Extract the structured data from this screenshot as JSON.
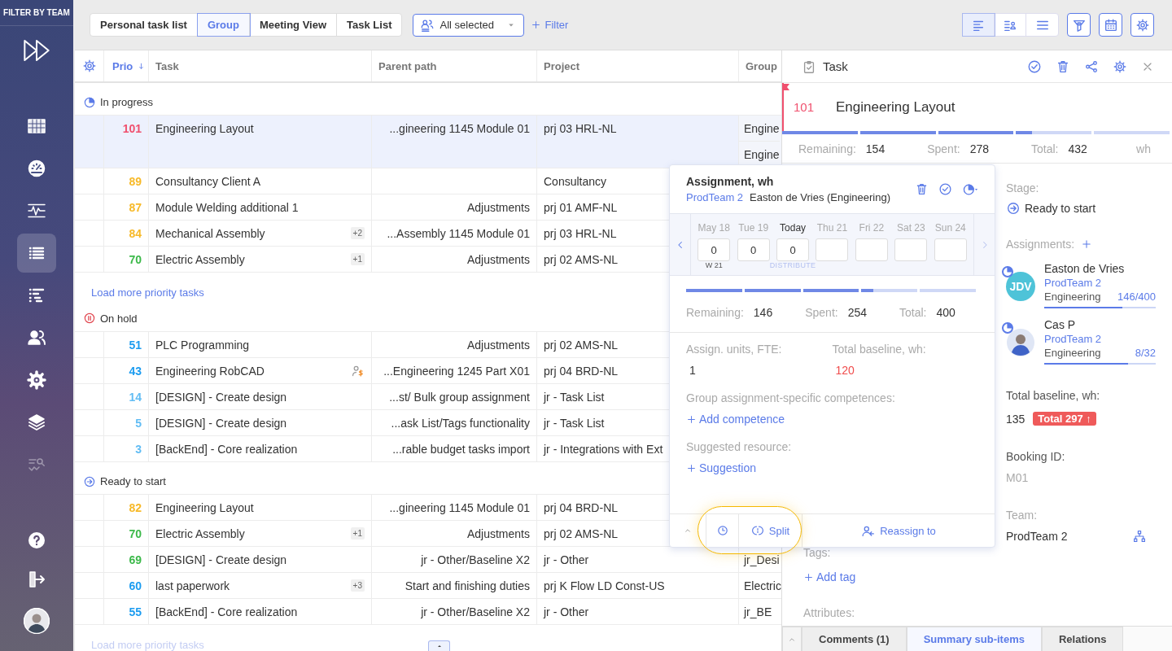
{
  "sidebar": {
    "title": "FILTER BY TEAM",
    "items": [
      {
        "selected": false,
        "disabled": false
      },
      {
        "selected": false,
        "disabled": false
      },
      {
        "selected": false,
        "disabled": false
      },
      {
        "selected": true,
        "disabled": false
      },
      {
        "selected": false,
        "disabled": false
      },
      {
        "selected": false,
        "disabled": false
      },
      {
        "selected": false,
        "disabled": false
      },
      {
        "selected": false,
        "disabled": false
      },
      {
        "selected": false,
        "disabled": true
      }
    ]
  },
  "toolbar": {
    "tabs": [
      {
        "label": "Personal task list",
        "selected": false
      },
      {
        "label": "Group",
        "selected": true
      },
      {
        "label": "Meeting View",
        "selected": false
      },
      {
        "label": "Task List",
        "selected": false
      }
    ],
    "team_filter": {
      "value": "All selected"
    },
    "add_filter": {
      "label": "Filter"
    },
    "view_modes": [
      {
        "selected": true
      },
      {
        "selected": false
      },
      {
        "selected": false
      }
    ]
  },
  "table": {
    "columns": [
      {
        "label": "Prio",
        "sorted": true
      },
      {
        "label": "Task",
        "sorted": false
      },
      {
        "label": "Parent path",
        "sorted": false
      },
      {
        "label": "Project",
        "sorted": false
      },
      {
        "label": "Group",
        "sorted": false
      }
    ],
    "sections": [
      {
        "title": "In progress",
        "kind": "in_progress",
        "rows": [
          {
            "prio": "101",
            "color": "#f0506e",
            "task": "Engineering Layout",
            "parent": "...gineering 1145 Module 01",
            "project": "prj 03 HRL-NL",
            "groups": [
              "Engine",
              "Engine"
            ],
            "cost_marker": false,
            "selected": true
          },
          {
            "prio": "89",
            "color": "#f7b928",
            "task": "Consultancy Client A",
            "project": "Consultancy",
            "cost_marker": false,
            "selected": false
          },
          {
            "prio": "87",
            "color": "#f7b928",
            "task": "Module Welding additional 1",
            "parent": "Adjustments",
            "project": "prj 01 AMF-NL",
            "cost_marker": false,
            "selected": false
          },
          {
            "prio": "84",
            "color": "#f7b928",
            "task": "Mechanical Assembly",
            "badge": "+2",
            "parent": "...Assembly 1145 Module 01",
            "project": "prj 03 HRL-NL",
            "cost_marker": false,
            "selected": false
          },
          {
            "prio": "70",
            "color": "#3cb94a",
            "task": "Electric Assembly",
            "badge": "+1",
            "parent": "Adjustments",
            "project": "prj 02 AMS-NL",
            "cost_marker": false,
            "selected": false
          }
        ],
        "load_more": {
          "label": "Load more priority tasks",
          "faded": false
        }
      },
      {
        "title": "On hold",
        "kind": "on_hold",
        "rows": [
          {
            "prio": "51",
            "color": "#1c9cf0",
            "task": "PLC Programming",
            "parent": "Adjustments",
            "project": "prj 02 AMS-NL",
            "cost_marker": false,
            "selected": false
          },
          {
            "prio": "43",
            "color": "#1c9cf0",
            "task": "Engineering RobCAD",
            "parent": "...Engineering 1245 Part X01",
            "project": "prj 04 BRD-NL",
            "cost_marker": true,
            "selected": false
          },
          {
            "prio": "14",
            "color": "#62bdf4",
            "task": "[DESIGN] - Create design",
            "parent": "...st/ Bulk group assignment",
            "project": "jr - Task List",
            "cost_marker": false,
            "selected": false
          },
          {
            "prio": "5",
            "color": "#62bdf4",
            "task": "[DESIGN] - Create design",
            "parent": "...ask List/Tags functionality",
            "project": "jr - Task List",
            "cost_marker": false,
            "selected": false
          },
          {
            "prio": "3",
            "color": "#62bdf4",
            "task": "[BackEnd] - Core realization",
            "parent": "...rable budget tasks import",
            "project": "jr - Integrations with Ext",
            "cost_marker": false,
            "selected": false
          }
        ]
      },
      {
        "title": "Ready to start",
        "kind": "ready",
        "rows": [
          {
            "prio": "82",
            "color": "#f7b928",
            "task": "Engineering Layout",
            "parent": "...gineering 1145 Module 01",
            "project": "prj 04 BRD-NL",
            "cost_marker": false,
            "selected": false
          },
          {
            "prio": "70",
            "color": "#3cb94a",
            "task": "Electric Assembly",
            "badge": "+1",
            "parent": "Adjustments",
            "project": "prj 02 AMS-NL",
            "cost_marker": false,
            "selected": false
          },
          {
            "prio": "69",
            "color": "#3cb94a",
            "task": "[DESIGN] - Create design",
            "parent": "jr - Other/Baseline X2",
            "project": "jr - Other",
            "groups": [
              "jr_Desi"
            ],
            "cost_marker": false,
            "selected": false
          },
          {
            "prio": "60",
            "color": "#1c9cf0",
            "task": "last paperwork",
            "badge": "+3",
            "parent": "Start and finishing duties",
            "project": "prj K Flow LD Const-US",
            "groups": [
              "Electric"
            ],
            "cost_marker": false,
            "selected": false
          },
          {
            "prio": "55",
            "color": "#1c9cf0",
            "task": "[BackEnd] - Core realization",
            "parent": "jr - Other/Baseline X2",
            "project": "jr - Other",
            "groups": [
              "jr_BE"
            ],
            "cost_marker": false,
            "selected": false
          }
        ],
        "load_more": {
          "label": "Load more priority tasks",
          "faded": true
        }
      }
    ]
  },
  "detail": {
    "title": "Task",
    "prio": "101",
    "name": "Engineering Layout",
    "progress": {
      "level": 0.64
    },
    "stats": [
      {
        "label": "Remaining:",
        "value": "154"
      },
      {
        "label": "Spent:",
        "value": "278"
      },
      {
        "label": "Total:",
        "value": "432"
      }
    ],
    "unit": "wh",
    "stage": {
      "label": "Stage:",
      "value": "Ready to start"
    },
    "assignments": {
      "label": "Assignments:",
      "people": [
        {
          "kind": "initials",
          "initials": "JDV",
          "name": "Easton de Vries",
          "team": "ProdTeam 2",
          "role": "Engineering",
          "hours": "146/400",
          "level": 0.7
        },
        {
          "kind": "picture",
          "name": "Cas P",
          "team": "ProdTeam 2",
          "role": "Engineering",
          "hours": "8/32",
          "level": 0.75
        }
      ]
    },
    "baseline": {
      "label": "Total baseline, wh:",
      "value": "135",
      "badge": "Total 297 ↑"
    },
    "booking": {
      "label": "Booking ID:",
      "value": "M01"
    },
    "team": {
      "label": "Team:",
      "value": "ProdTeam 2"
    },
    "tags": {
      "label": "Tags:",
      "action": "Add tag"
    },
    "attributes": {
      "label": "Attributes:"
    },
    "tabs": [
      {
        "label": "Comments (1)",
        "selected": false
      },
      {
        "label": "Summary sub-items",
        "selected": true
      },
      {
        "label": "Relations",
        "selected": false
      }
    ]
  },
  "assignment_popup": {
    "title": "Assignment, wh",
    "team": "ProdTeam 2",
    "person": "Easton de Vries (Engineering)",
    "days": [
      {
        "label": "May 18",
        "value": "0",
        "today": false,
        "note": {
          "text": "W 21",
          "kind": "week"
        }
      },
      {
        "label": "Tue 19",
        "value": "0",
        "today": false
      },
      {
        "label": "Today",
        "value": "0",
        "today": true,
        "note": {
          "text": "DISTRIBUTE",
          "kind": "action"
        }
      },
      {
        "label": "Thu 21",
        "today": false
      },
      {
        "label": "Fri 22",
        "today": false
      },
      {
        "label": "Sat 23",
        "today": false
      },
      {
        "label": "Sun 24",
        "today": false
      }
    ],
    "progress": {
      "level": 0.64
    },
    "stats": [
      {
        "label": "Remaining:",
        "value": "146"
      },
      {
        "label": "Spent:",
        "value": "254"
      },
      {
        "label": "Total:",
        "value": "400"
      }
    ],
    "fields": [
      {
        "label": "Assign. units, FTE:",
        "value": "1",
        "alert": false
      },
      {
        "label": "Total baseline, wh:",
        "value": "120",
        "alert": true
      }
    ],
    "competences": {
      "label": "Group assignment-specific competences:",
      "action": "Add competence"
    },
    "suggested": {
      "label": "Suggested resource:",
      "action": "Suggestion"
    },
    "footer": {
      "split": "Split",
      "reassign": "Reassign to",
      "highlighted": true
    }
  }
}
